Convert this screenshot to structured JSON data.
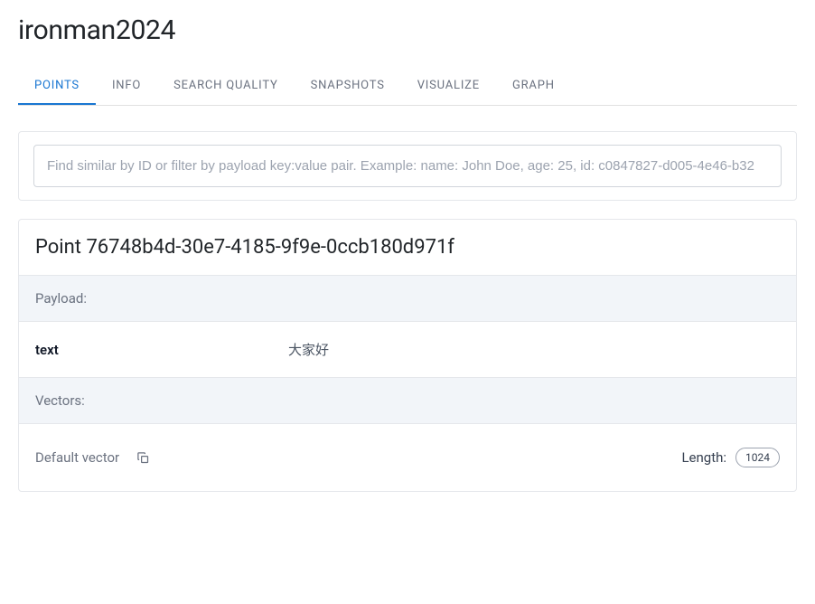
{
  "title": "ironman2024",
  "tabs": [
    {
      "label": "POINTS",
      "active": true
    },
    {
      "label": "INFO",
      "active": false
    },
    {
      "label": "SEARCH QUALITY",
      "active": false
    },
    {
      "label": "SNAPSHOTS",
      "active": false
    },
    {
      "label": "VISUALIZE",
      "active": false
    },
    {
      "label": "GRAPH",
      "active": false
    }
  ],
  "search": {
    "placeholder": "Find similar by ID or filter by payload key:value pair. Example: name: John Doe, age: 25, id: c0847827-d005-4e46-b32"
  },
  "point": {
    "header": "Point 76748b4d-30e7-4185-9f9e-0ccb180d971f",
    "payload_label": "Payload:",
    "payload": {
      "key": "text",
      "value": "大家好"
    },
    "vectors_label": "Vectors:",
    "vector": {
      "name": "Default vector",
      "length_label": "Length:",
      "length_value": "1024"
    }
  }
}
